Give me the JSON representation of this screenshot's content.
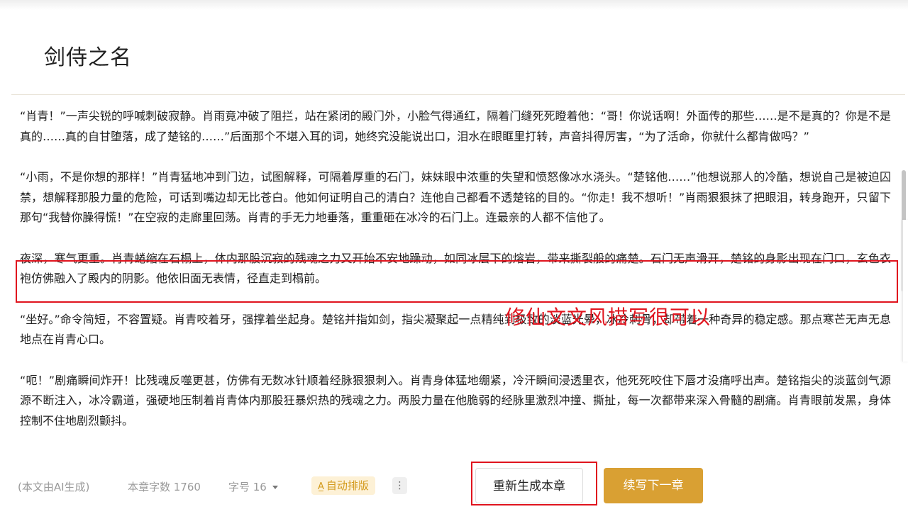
{
  "chapter": {
    "title": "剑侍之名"
  },
  "paragraphs": [
    "“肖青！”一声尖锐的呼喊刺破寂静。肖雨竟冲破了阻拦，站在紧闭的殿门外，小脸气得通红，隔着门缝死死瞪着他：“哥！你说话啊！外面传的那些……是不是真的？你是不是真的……真的自甘堕落，成了楚铭的……”后面那个不堪入耳的词，她终究没能说出口，泪水在眼眶里打转，声音抖得厉害，“为了活命，你就什么都肯做吗？”",
    "“小雨，不是你想的那样！”肖青猛地冲到门边，试图解释，可隔着厚重的石门，妹妹眼中浓重的失望和愤怒像冰水浇头。“楚铭他……”他想说那人的冷酷，想说自己是被迫囚禁，想解释那股力量的危险，可话到嘴边却无比苍白。他如何证明自己的清白？连他自己都看不透楚铭的目的。“你走！我不想听！”肖雨狠狠抹了把眼泪，转身跑开，只留下那句“我替你臊得慌！”在空寂的走廊里回荡。肖青的手无力地垂落，重重砸在冰冷的石门上。连最亲的人都不信他了。",
    "夜深，寒气更重。肖青蜷缩在石榻上，体内那股沉寂的残魂之力又开始不安地躁动，如同冰层下的熔岩，带来撕裂般的痛楚。石门无声滑开，楚铭的身影出现在门口，玄色衣袍仿佛融入了殿内的阴影。他依旧面无表情，径直走到榻前。",
    "“坐好。”命令简短，不容置疑。肖青咬着牙，强撑着坐起身。楚铭并指如剑，指尖凝聚起一点精纯到极致的淡蓝光晕，冰冷刺骨，却带着一种奇异的稳定感。那点寒芒无声无息地点在肖青心口。",
    "“呃！”剧痛瞬间炸开！比残魂反噬更甚，仿佛有无数冰针顺着经脉狠狠刺入。肖青身体猛地绷紧，冷汗瞬间浸透里衣，他死死咬住下唇才没痛呼出声。楚铭指尖的淡蓝剑气源源不断注入，冰冷霸道，强硬地压制着肖青体内那股狂暴炽热的残魂之力。两股力量在他脆弱的经脉里激烈冲撞、撕扯，每一次都带来深入骨髓的剧痛。肖青眼前发黑，身体控制不住地剧烈颤抖。"
  ],
  "annotation": {
    "text": "修仙文文风描写很可以"
  },
  "footer": {
    "ai_note": "(本文由AI生成)",
    "word_count": "本章字数 1760",
    "font_size": "字号 16",
    "auto_layout": "自动排版",
    "more": "⋮",
    "regenerate": "重新生成本章",
    "continue": "续写下一章"
  },
  "colors": {
    "accent": "#d9a033",
    "highlight_red": "#e0141e",
    "auto_bg": "#fdf1d6"
  },
  "icons": {
    "auto_layout_icon": "text-format-icon",
    "font_caret": "chevron-down-icon",
    "more_icon": "vertical-dots-icon"
  }
}
